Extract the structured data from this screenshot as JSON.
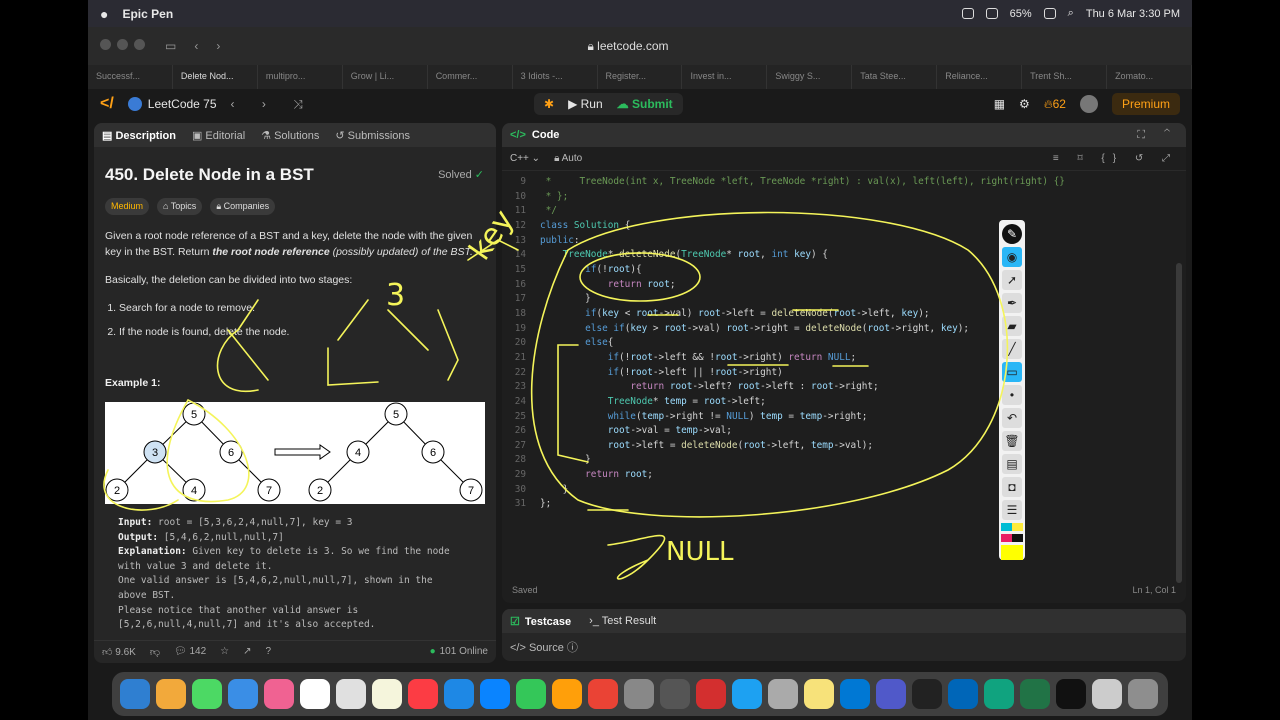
{
  "menubar": {
    "app_name": "Epic Pen",
    "battery": "65%",
    "datetime": "Thu 6 Mar  3:30 PM"
  },
  "browser": {
    "url": "leetcode.com",
    "tabs": [
      "Successf...",
      "Delete Nod...",
      "multipro...",
      "Grow | Li...",
      "Commer...",
      "3 Idiots -...",
      "Register...",
      "Invest in...",
      "Swiggy S...",
      "Tata Stee...",
      "Reliance...",
      "Trent Sh...",
      "Zomato..."
    ]
  },
  "nav": {
    "list_name": "LeetCode 75",
    "run_label": "Run",
    "submit_label": "Submit",
    "streak": "62",
    "premium_label": "Premium"
  },
  "left_tabs": {
    "description": "Description",
    "editorial": "Editorial",
    "solutions": "Solutions",
    "submissions": "Submissions"
  },
  "problem": {
    "title": "450. Delete Node in a BST",
    "status": "Solved",
    "difficulty": "Medium",
    "topics_label": "Topics",
    "companies_label": "Companies",
    "para1_a": "Given a root node reference of a BST and a key, delete the node with the given key in the BST. Return ",
    "para1_b": "the root node reference",
    "para1_c": " (possibly updated) of the BST.",
    "para2": "Basically, the deletion can be divided into two stages:",
    "step1": "Search for a node to remove.",
    "step2": "If the node is found, delete the node.",
    "example_heading": "Example 1:",
    "input_label": "Input:",
    "input_value": " root = [5,3,6,2,4,null,7], key = 3",
    "output_label": "Output:",
    "output_value": " [5,4,6,2,null,null,7]",
    "explanation_label": "Explanation:",
    "explanation_l1": " Given key to delete is 3. So we find the node",
    "explanation_l2": "with value 3 and delete it.",
    "explanation_l3": "One valid answer is [5,4,6,2,null,null,7], shown in the",
    "explanation_l4": "above BST.",
    "explanation_l5": "Please notice that another valid answer is",
    "explanation_l6": "[5,2,6,null,4,null,7] and it's also accepted."
  },
  "footer": {
    "likes": "9.6K",
    "comments": "142",
    "online": "101 Online"
  },
  "editor": {
    "panel_title": "Code",
    "language": "C++",
    "mode": "Auto",
    "status": "Saved",
    "cursor": "Ln 1, Col 1",
    "lines": [
      {
        "n": "9",
        "t": " *     TreeNode(int x, TreeNode *left, TreeNode *right) : val(x), left(left), right(right) {}"
      },
      {
        "n": "10",
        "t": " * };"
      },
      {
        "n": "11",
        "t": " */"
      },
      {
        "n": "12",
        "t": "class Solution {"
      },
      {
        "n": "13",
        "t": "public:"
      },
      {
        "n": "14",
        "t": "    TreeNode* deleteNode(TreeNode* root, int key) {"
      },
      {
        "n": "15",
        "t": "        if(!root){"
      },
      {
        "n": "16",
        "t": "            return root;"
      },
      {
        "n": "17",
        "t": "        }"
      },
      {
        "n": "18",
        "t": "        if(key < root->val) root->left = deleteNode(root->left, key);"
      },
      {
        "n": "19",
        "t": "        else if(key > root->val) root->right = deleteNode(root->right, key);"
      },
      {
        "n": "20",
        "t": "        else{"
      },
      {
        "n": "21",
        "t": "            if(!root->left && !root->right) return NULL;"
      },
      {
        "n": "22",
        "t": "            if(!root->left || !root->right)"
      },
      {
        "n": "23",
        "t": "                return root->left? root->left : root->right;"
      },
      {
        "n": "24",
        "t": "            TreeNode* temp = root->left;"
      },
      {
        "n": "25",
        "t": "            while(temp->right != NULL) temp = temp->right;"
      },
      {
        "n": "26",
        "t": "            root->val = temp->val;"
      },
      {
        "n": "27",
        "t": "            root->left = deleteNode(root->left, temp->val);"
      },
      {
        "n": "28",
        "t": "        }"
      },
      {
        "n": "29",
        "t": "        return root;"
      },
      {
        "n": "30",
        "t": "    }"
      },
      {
        "n": "31",
        "t": "};"
      }
    ]
  },
  "test": {
    "testcase_label": "Testcase",
    "result_label": "Test Result",
    "source_label": "Source"
  },
  "tree_before": [
    "5",
    "3",
    "6",
    "2",
    "4",
    "7"
  ],
  "tree_after": [
    "5",
    "4",
    "6",
    "2",
    "7"
  ],
  "handwriting": {
    "note1": "3",
    "note2": "NULL",
    "note3": "key"
  }
}
